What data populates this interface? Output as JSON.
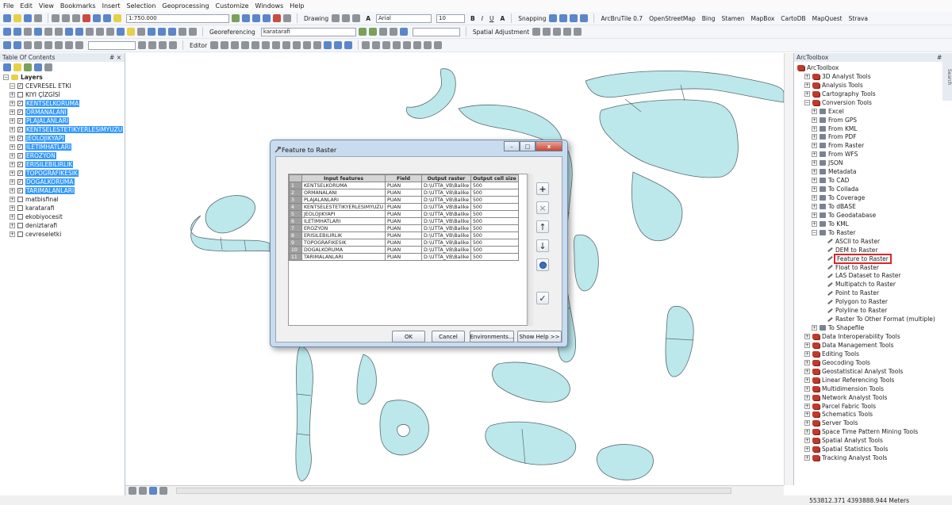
{
  "menu": [
    "File",
    "Edit",
    "View",
    "Bookmarks",
    "Insert",
    "Selection",
    "Geoprocessing",
    "Customize",
    "Windows",
    "Help"
  ],
  "toolbar1": {
    "scale": "1:750.000",
    "drawing_label": "Drawing",
    "font_name": "Arial",
    "font_size": "10",
    "bold_label": "B",
    "italic_label": "I",
    "underline_label": "U",
    "fontcolor_label": "A",
    "snapping_label": "Snapping",
    "basemaps": [
      "ArcBruTile 0.7",
      "OpenStreetMap",
      "Bing",
      "Stamen",
      "MapBox",
      "CartoDB",
      "MapQuest",
      "Strava"
    ]
  },
  "toolbar2": {
    "georef_label": "Georeferencing",
    "georef_layer": "karatarafi",
    "spatial_adj_label": "Spatial Adjustment"
  },
  "toolbar3": {
    "editor_label": "Editor"
  },
  "toc": {
    "title": "Table Of Contents",
    "pin": "# ×",
    "group": "Layers",
    "layers": [
      {
        "name": "CEVRESEL ETKI",
        "checked": true,
        "selected": false,
        "exp": "−"
      },
      {
        "name": "KIYI ÇİZGİSİ",
        "checked": false,
        "selected": false,
        "exp": "+"
      },
      {
        "name": "KENTSELKORUMA",
        "checked": true,
        "selected": true,
        "exp": "+"
      },
      {
        "name": "ORMANALANI",
        "checked": true,
        "selected": true,
        "exp": "+"
      },
      {
        "name": "PLAJALANLARI",
        "checked": true,
        "selected": true,
        "exp": "+"
      },
      {
        "name": "KENTSELESTETIKYERLESIMYUZU",
        "checked": true,
        "selected": true,
        "exp": "+"
      },
      {
        "name": "JEOLOJIKYAPI",
        "checked": true,
        "selected": true,
        "exp": "+"
      },
      {
        "name": "ILETIMHATLARI",
        "checked": true,
        "selected": true,
        "exp": "+"
      },
      {
        "name": "EROZYON",
        "checked": true,
        "selected": true,
        "exp": "+"
      },
      {
        "name": "ERISILEBILIRLIK",
        "checked": true,
        "selected": true,
        "exp": "+"
      },
      {
        "name": "TOPOGRAFIKESIK",
        "checked": true,
        "selected": true,
        "exp": "+"
      },
      {
        "name": "DOGALKORUMA",
        "checked": true,
        "selected": true,
        "exp": "+"
      },
      {
        "name": "TARIMALANLARI",
        "checked": true,
        "selected": true,
        "exp": "+"
      },
      {
        "name": "matbisfinal",
        "checked": false,
        "selected": false,
        "exp": "+"
      },
      {
        "name": "karatarafi",
        "checked": false,
        "selected": false,
        "exp": "+"
      },
      {
        "name": "ekobiyocesit",
        "checked": false,
        "selected": false,
        "exp": "+"
      },
      {
        "name": "deniztarafi",
        "checked": false,
        "selected": false,
        "exp": "+"
      },
      {
        "name": "cevreseletki",
        "checked": false,
        "selected": false,
        "exp": "+"
      }
    ]
  },
  "toolbox": {
    "title": "ArcToolbox",
    "pin": "# ×",
    "root": "ArcToolbox",
    "side_tab": "Search",
    "items": [
      {
        "label": "3D Analyst Tools",
        "level": 1,
        "kind": "toolbox",
        "exp": "+"
      },
      {
        "label": "Analysis Tools",
        "level": 1,
        "kind": "toolbox",
        "exp": "+"
      },
      {
        "label": "Cartography Tools",
        "level": 1,
        "kind": "toolbox",
        "exp": "+"
      },
      {
        "label": "Conversion Tools",
        "level": 1,
        "kind": "toolbox",
        "exp": "−"
      },
      {
        "label": "Excel",
        "level": 2,
        "kind": "toolset",
        "exp": "+"
      },
      {
        "label": "From GPS",
        "level": 2,
        "kind": "toolset",
        "exp": "+"
      },
      {
        "label": "From KML",
        "level": 2,
        "kind": "toolset",
        "exp": "+"
      },
      {
        "label": "From PDF",
        "level": 2,
        "kind": "toolset",
        "exp": "+"
      },
      {
        "label": "From Raster",
        "level": 2,
        "kind": "toolset",
        "exp": "+"
      },
      {
        "label": "From WFS",
        "level": 2,
        "kind": "toolset",
        "exp": "+"
      },
      {
        "label": "JSON",
        "level": 2,
        "kind": "toolset",
        "exp": "+"
      },
      {
        "label": "Metadata",
        "level": 2,
        "kind": "toolset",
        "exp": "+"
      },
      {
        "label": "To CAD",
        "level": 2,
        "kind": "toolset",
        "exp": "+"
      },
      {
        "label": "To Collada",
        "level": 2,
        "kind": "toolset",
        "exp": "+"
      },
      {
        "label": "To Coverage",
        "level": 2,
        "kind": "toolset",
        "exp": "+"
      },
      {
        "label": "To dBASE",
        "level": 2,
        "kind": "toolset",
        "exp": "+"
      },
      {
        "label": "To Geodatabase",
        "level": 2,
        "kind": "toolset",
        "exp": "+"
      },
      {
        "label": "To KML",
        "level": 2,
        "kind": "toolset",
        "exp": "+"
      },
      {
        "label": "To Raster",
        "level": 2,
        "kind": "toolset",
        "exp": "−"
      },
      {
        "label": "ASCII to Raster",
        "level": 3,
        "kind": "tool"
      },
      {
        "label": "DEM to Raster",
        "level": 3,
        "kind": "tool"
      },
      {
        "label": "Feature to Raster",
        "level": 3,
        "kind": "tool",
        "highlight": true
      },
      {
        "label": "Float to Raster",
        "level": 3,
        "kind": "tool"
      },
      {
        "label": "LAS Dataset to Raster",
        "level": 3,
        "kind": "tool"
      },
      {
        "label": "Multipatch to Raster",
        "level": 3,
        "kind": "tool"
      },
      {
        "label": "Point to Raster",
        "level": 3,
        "kind": "tool"
      },
      {
        "label": "Polygon to Raster",
        "level": 3,
        "kind": "tool"
      },
      {
        "label": "Polyline to Raster",
        "level": 3,
        "kind": "tool"
      },
      {
        "label": "Raster To Other Format (multiple)",
        "level": 3,
        "kind": "script"
      },
      {
        "label": "To Shapefile",
        "level": 2,
        "kind": "toolset",
        "exp": "+"
      },
      {
        "label": "Data Interoperability Tools",
        "level": 1,
        "kind": "toolbox",
        "exp": "+"
      },
      {
        "label": "Data Management Tools",
        "level": 1,
        "kind": "toolbox",
        "exp": "+"
      },
      {
        "label": "Editing Tools",
        "level": 1,
        "kind": "toolbox",
        "exp": "+"
      },
      {
        "label": "Geocoding Tools",
        "level": 1,
        "kind": "toolbox",
        "exp": "+"
      },
      {
        "label": "Geostatistical Analyst Tools",
        "level": 1,
        "kind": "toolbox",
        "exp": "+"
      },
      {
        "label": "Linear Referencing Tools",
        "level": 1,
        "kind": "toolbox",
        "exp": "+"
      },
      {
        "label": "Multidimension Tools",
        "level": 1,
        "kind": "toolbox",
        "exp": "+"
      },
      {
        "label": "Network Analyst Tools",
        "level": 1,
        "kind": "toolbox",
        "exp": "+"
      },
      {
        "label": "Parcel Fabric Tools",
        "level": 1,
        "kind": "toolbox",
        "exp": "+"
      },
      {
        "label": "Schematics Tools",
        "level": 1,
        "kind": "toolbox",
        "exp": "+"
      },
      {
        "label": "Server Tools",
        "level": 1,
        "kind": "toolbox",
        "exp": "+"
      },
      {
        "label": "Space Time Pattern Mining Tools",
        "level": 1,
        "kind": "toolbox",
        "exp": "+"
      },
      {
        "label": "Spatial Analyst Tools",
        "level": 1,
        "kind": "toolbox",
        "exp": "+"
      },
      {
        "label": "Spatial Statistics Tools",
        "level": 1,
        "kind": "toolbox",
        "exp": "+"
      },
      {
        "label": "Tracking Analyst Tools",
        "level": 1,
        "kind": "toolbox",
        "exp": "+"
      }
    ]
  },
  "dialog": {
    "title": "Feature to Raster",
    "columns": [
      "Input features",
      "Field",
      "Output raster",
      "Output cell size"
    ],
    "rows": [
      [
        "1",
        "KENTSELKORUMA",
        "PUAN",
        "D:\\UTTA_VB\\Balike",
        "500"
      ],
      [
        "2",
        "ORMANALANI",
        "PUAN",
        "D:\\UTTA_VB\\Balike",
        "500"
      ],
      [
        "3",
        "PLAJALANLARI",
        "PUAN",
        "D:\\UTTA_VB\\Balike",
        "500"
      ],
      [
        "4",
        "KENTSELESTETIKYERLESIMYUZU",
        "PUAN",
        "D:\\UTTA_VB\\Balike",
        "500"
      ],
      [
        "5",
        "JEOLOJIKYAPI",
        "PUAN",
        "D:\\UTTA_VB\\Balike",
        "500"
      ],
      [
        "6",
        "ILETIMHATLARI",
        "PUAN",
        "D:\\UTTA_VB\\Balike",
        "500"
      ],
      [
        "7",
        "EROZYON",
        "PUAN",
        "D:\\UTTA_VB\\Balike",
        "500"
      ],
      [
        "8",
        "ERISILEBILIRLIK",
        "PUAN",
        "D:\\UTTA_VB\\Balike",
        "500"
      ],
      [
        "9",
        "TOPOGRAFIKESIK",
        "PUAN",
        "D:\\UTTA_VB\\Balike",
        "500"
      ],
      [
        "10",
        "DOGALKORUMA",
        "PUAN",
        "D:\\UTTA_VB\\Balike",
        "500"
      ],
      [
        "11",
        "TARIMALANLARI",
        "PUAN",
        "D:\\UTTA_VB\\Balike",
        "500"
      ]
    ],
    "ok_label": "OK",
    "cancel_label": "Cancel",
    "env_label": "Environments...",
    "help_label": "Show Help >>",
    "side_buttons": {
      "add": "+",
      "remove": "×",
      "up": "↑",
      "down": "↓",
      "check": "✓"
    },
    "win_buttons": {
      "min": "–",
      "max": "□",
      "close": "x"
    }
  },
  "status": {
    "coords": "553812.371  4393888.944 Meters"
  },
  "colors": {
    "feature_fill": "#bce8ec",
    "feature_stroke": "#5a6a6e",
    "selection": "#3399ff",
    "highlight_box": "#d9262c"
  }
}
